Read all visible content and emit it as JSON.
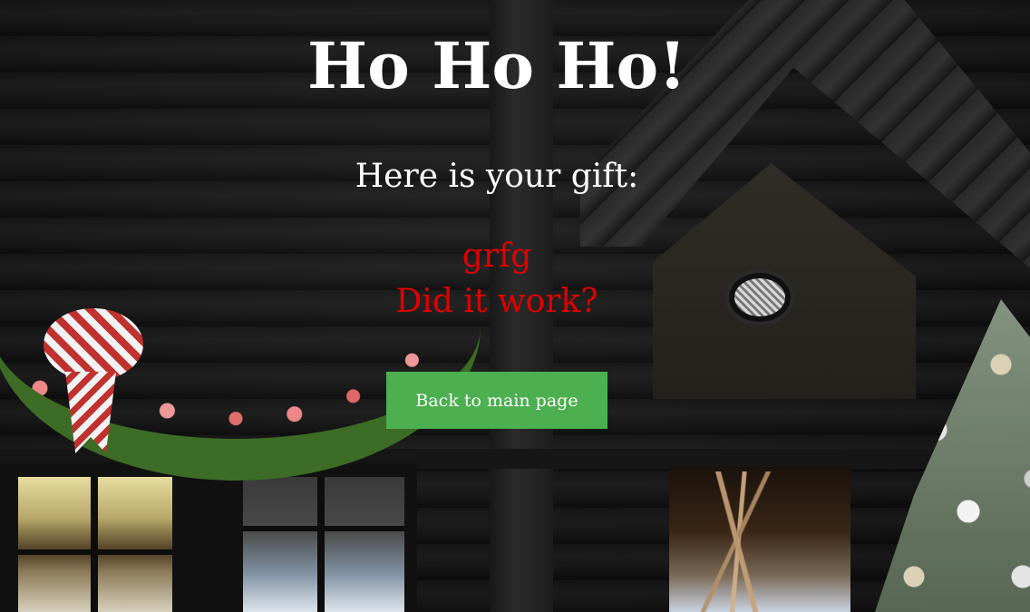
{
  "page": {
    "title": "Ho Ho Ho!",
    "subtitle": "Here is your gift:",
    "gift_lines": [
      "grfg",
      "Did it work?"
    ],
    "back_button_label": "Back to main page"
  },
  "colors": {
    "title": "#ffffff",
    "gift_text": "#e00000",
    "button_bg": "#4caf50",
    "button_text": "#ffffff"
  },
  "icons": []
}
